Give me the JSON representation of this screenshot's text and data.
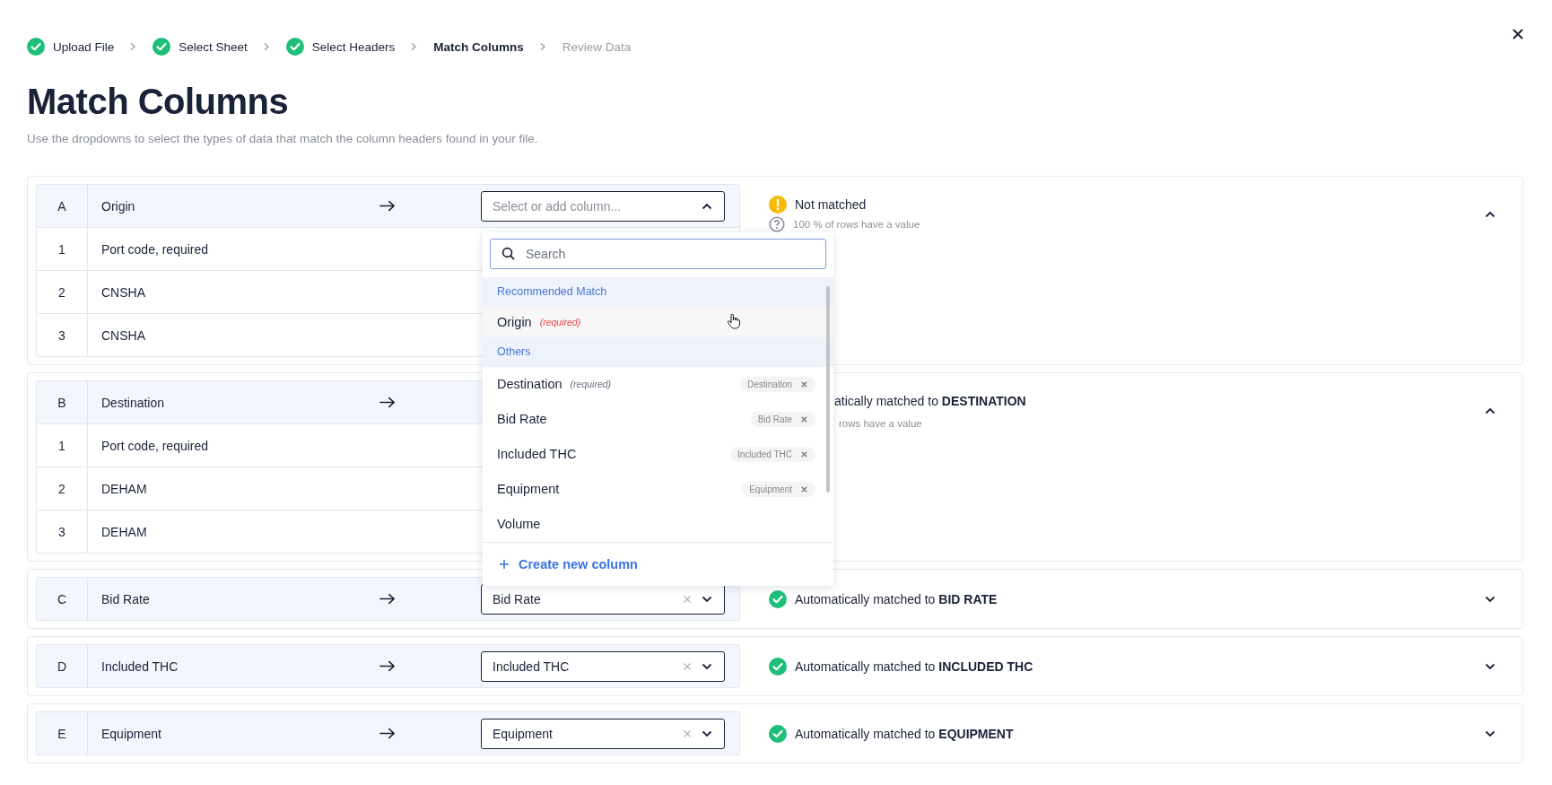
{
  "steps": [
    {
      "label": "Upload File",
      "completed": true,
      "selected": false
    },
    {
      "label": "Select Sheet",
      "completed": true,
      "selected": false
    },
    {
      "label": "Select Headers",
      "completed": true,
      "selected": false
    },
    {
      "label": "Match Columns",
      "completed": false,
      "selected": true
    },
    {
      "label": "Review Data",
      "completed": false,
      "selected": false
    }
  ],
  "title": "Match Columns",
  "subtitle": "Use the dropdowns to select the types of data that match the column headers found in your file.",
  "columns": [
    {
      "letter": "A",
      "name": "Origin",
      "expanded": true,
      "select": {
        "placeholder": "Select or add column...",
        "open": true
      },
      "samples": [
        {
          "index": "1",
          "value": "Port code, required"
        },
        {
          "index": "2",
          "value": "CNSHA"
        },
        {
          "index": "3",
          "value": "CNSHA"
        }
      ],
      "status": {
        "kind": "unmatched",
        "text": "Not matched",
        "detail": "100 % of rows have a value"
      }
    },
    {
      "letter": "B",
      "name": "Destination",
      "expanded": true,
      "samples": [
        {
          "index": "1",
          "value": "Port code, required"
        },
        {
          "index": "2",
          "value": "DEHAM"
        },
        {
          "index": "3",
          "value": "DEHAM"
        }
      ],
      "status": {
        "kind": "covered",
        "text": "atically matched to **DESTINATION**",
        "detail": "rows have a value"
      }
    },
    {
      "letter": "C",
      "name": "Bid Rate",
      "expanded": false,
      "select": {
        "value": "Bid Rate",
        "open": false
      },
      "status": {
        "kind": "matched",
        "text": "Automatically matched to **BID RATE**"
      }
    },
    {
      "letter": "D",
      "name": "Included THC",
      "expanded": false,
      "select": {
        "value": "Included THC",
        "open": false
      },
      "status": {
        "kind": "matched",
        "text": "Automatically matched to **INCLUDED THC**"
      }
    },
    {
      "letter": "E",
      "name": "Equipment",
      "expanded": false,
      "select": {
        "value": "Equipment",
        "open": false
      },
      "status": {
        "kind": "matched",
        "text": "Automatically matched to **EQUIPMENT**"
      }
    }
  ],
  "dropdown": {
    "search_placeholder": "Search",
    "groups": [
      {
        "heading": "Recommended Match",
        "options": [
          {
            "label": "Origin",
            "note": "(required)",
            "color": "#e5484d",
            "hovered": true
          }
        ]
      },
      {
        "heading": "Others",
        "options": [
          {
            "label": "Destination",
            "note": "(required)",
            "color": "#6b7280",
            "tag": "Destination",
            "hovered": false
          },
          {
            "label": "Bid Rate",
            "tag": "Bid Rate",
            "hovered": false
          },
          {
            "label": "Included THC",
            "tag": "Included THC",
            "hovered": false
          },
          {
            "label": "Equipment",
            "tag": "Equipment",
            "hovered": false
          },
          {
            "label": "Volume",
            "hovered": false
          }
        ]
      }
    ],
    "create_label": "Create new column"
  }
}
